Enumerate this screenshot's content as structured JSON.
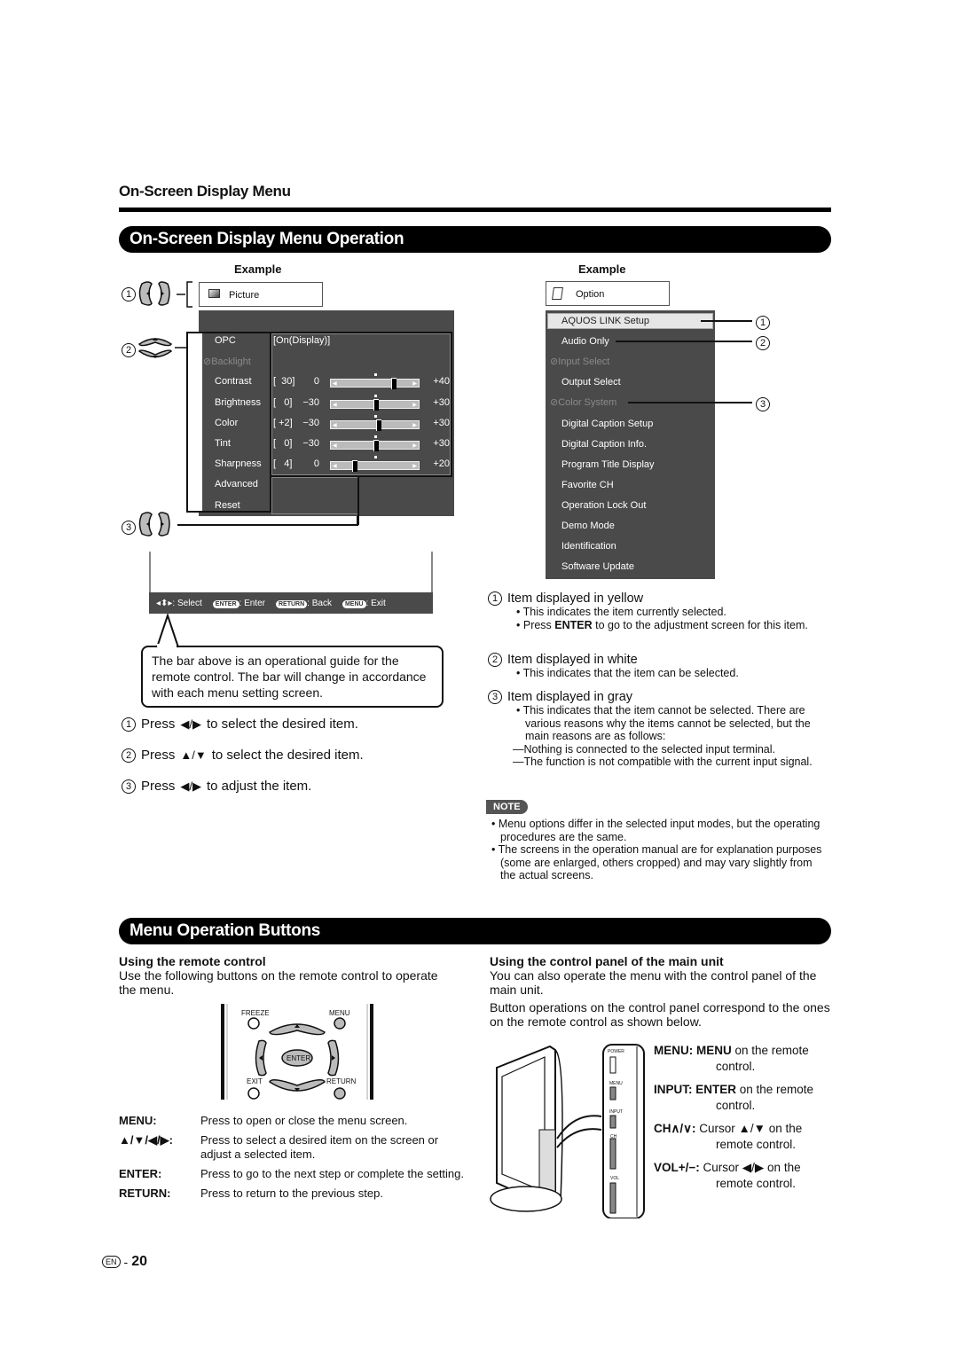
{
  "section_title": "On-Screen Display Menu",
  "banner1": "On-Screen Display Menu Operation",
  "banner2": "Menu Operation Buttons",
  "left_example": {
    "label": "Example",
    "header_icon": "picture-icon",
    "header": "Picture",
    "callouts": [
      "1",
      "2",
      "3"
    ],
    "items": [
      {
        "label": "OPC",
        "state": "normal",
        "value": "[On(Display)]"
      },
      {
        "label": "Backlight",
        "state": "disabled"
      },
      {
        "label": "Contrast",
        "state": "normal",
        "value": "[  30]",
        "min": "0",
        "max": "+40",
        "level": 30
      },
      {
        "label": "Brightness",
        "state": "normal",
        "value": "[   0]",
        "min": "−30",
        "max": "+30",
        "level": 0
      },
      {
        "label": "Color",
        "state": "normal",
        "value": "[ +2]",
        "min": "−30",
        "max": "+30",
        "level": 2
      },
      {
        "label": "Tint",
        "state": "normal",
        "value": "[   0]",
        "min": "−30",
        "max": "+30",
        "level": 0
      },
      {
        "label": "Sharpness",
        "state": "normal",
        "value": "[   4]",
        "min": "0",
        "max": "+20",
        "level": 4
      },
      {
        "label": "Advanced",
        "state": "normal"
      },
      {
        "label": "Reset",
        "state": "normal"
      }
    ],
    "guide_bar": {
      "select": ": Select",
      "enter_key": "ENTER",
      "enter": ": Enter",
      "return_key": "RETURN",
      "back": ": Back",
      "menu_key": "MENU",
      "exit": ": Exit"
    }
  },
  "callout_text": "The bar above is an operational guide for the remote control. The bar will change in accordance with each menu setting screen.",
  "steps": [
    {
      "num": "1",
      "pre": "Press",
      "keys": "◀/▶",
      "post": "to select the desired item."
    },
    {
      "num": "2",
      "pre": "Press",
      "keys": "▲/▼",
      "post": "to select the desired item."
    },
    {
      "num": "3",
      "pre": "Press",
      "keys": "◀/▶",
      "post": "to adjust the item."
    }
  ],
  "right_example": {
    "label": "Example",
    "header_icon": "option-icon",
    "header": "Option",
    "items": [
      {
        "label": "AQUOS LINK Setup",
        "state": "selected",
        "callout": "1"
      },
      {
        "label": "Audio Only",
        "state": "normal",
        "callout": "2"
      },
      {
        "label": "Input Select",
        "state": "disabled"
      },
      {
        "label": "Output Select",
        "state": "normal"
      },
      {
        "label": "Color System",
        "state": "disabled",
        "callout": "3"
      },
      {
        "label": "Digital Caption Setup",
        "state": "normal"
      },
      {
        "label": "Digital Caption Info.",
        "state": "normal"
      },
      {
        "label": "Program Title Display",
        "state": "normal"
      },
      {
        "label": "Favorite CH",
        "state": "normal"
      },
      {
        "label": "Operation Lock Out",
        "state": "normal"
      },
      {
        "label": "Demo Mode",
        "state": "normal"
      },
      {
        "label": "Identification",
        "state": "normal"
      },
      {
        "label": "Software Update",
        "state": "normal"
      }
    ]
  },
  "legend": [
    {
      "num": "1",
      "title": "Item displayed in yellow",
      "bullets": [
        "This indicates the item currently selected.",
        "Press |ENTER| to go to the adjustment screen for this item."
      ]
    },
    {
      "num": "2",
      "title": "Item displayed in white",
      "bullets": [
        "This indicates that the item can be selected."
      ]
    },
    {
      "num": "3",
      "title": "Item displayed in gray",
      "bullets": [
        "This indicates that the item cannot be selected. There are various reasons why the items cannot be selected, but the main reasons are as follows:"
      ],
      "dashes": [
        "Nothing is connected to the selected input terminal.",
        "The function is not compatible with the current input signal."
      ]
    }
  ],
  "note": {
    "badge": "NOTE",
    "bullets": [
      "Menu options differ in the selected input modes, but the operating procedures are the same.",
      "The screens in the operation manual are for explanation purposes (some are enlarged, others cropped) and may vary slightly from the actual screens."
    ]
  },
  "remote": {
    "heading": "Using the remote control",
    "intro": "Use the following buttons on the remote control to operate the menu.",
    "button_labels": {
      "freeze": "FREEZE",
      "menu": "MENU",
      "enter": "ENTER",
      "exit": "EXIT",
      "return": "RETURN"
    },
    "keys": [
      {
        "key": "MENU:",
        "desc": "Press to open or close the menu screen."
      },
      {
        "key": "▲/▼/◀/▶:",
        "desc": "Press to select a desired item on the screen or adjust a selected item."
      },
      {
        "key": "ENTER:",
        "desc": "Press to go to the next step or complete the setting."
      },
      {
        "key": "RETURN:",
        "desc": "Press to return to the previous step."
      }
    ]
  },
  "panel": {
    "heading": "Using the control panel of the main unit",
    "intro1": "You can also operate the menu with the control panel of the main unit.",
    "intro2": "Button operations on the control panel correspond to the ones on the remote control as shown below.",
    "panel_labels": [
      "POWER",
      "MENU",
      "INPUT",
      "CH",
      "VOL"
    ],
    "mappings": [
      {
        "key": "MENU:",
        "bold": "MENU",
        "rest": " on the remote control."
      },
      {
        "key": "INPUT:",
        "bold": "ENTER",
        "rest": " on the remote control."
      },
      {
        "key": "CH∧/∨:",
        "bold": "",
        "rest": "Cursor ▲/▼ on the remote control."
      },
      {
        "key": "VOL+/−:",
        "bold": "",
        "rest": "Cursor ◀/▶ on the remote control."
      }
    ]
  },
  "footer": {
    "lang": "EN",
    "page": "20"
  }
}
